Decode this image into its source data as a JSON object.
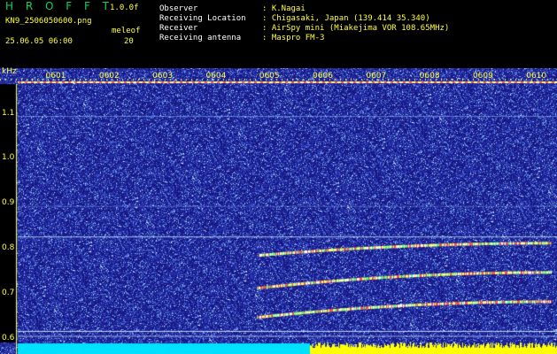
{
  "header": {
    "app_name": "H R O F F T",
    "version": "1.0.0f",
    "filename": "KN9_2506050600.png",
    "datetime": "25.06.05 06:00",
    "shower_code": "meleof",
    "shower_value": "20",
    "fields": [
      {
        "label": "Observer",
        "value": ": K.Nagai"
      },
      {
        "label": "Receiving Location",
        "value": ": Chigasaki, Japan (139.414 35.340)"
      },
      {
        "label": "Receiver",
        "value": ": AirSpy mini (Miakejima VOR 108.65MHz)"
      },
      {
        "label": "Receiving antenna",
        "value": ": Maspro FM-3"
      }
    ]
  },
  "chart_data": {
    "type": "heatmap",
    "ylabel": "kHz",
    "ylim": [
      0.57,
      1.19
    ],
    "x_ticks": [
      "0601",
      "0602",
      "0603",
      "0604",
      "0605",
      "0606",
      "0607",
      "0608",
      "0609",
      "0610"
    ],
    "y_ticks": [
      {
        "label": "1.1",
        "value": 1.1
      },
      {
        "label": "1.0",
        "value": 1.0
      },
      {
        "label": "0.9",
        "value": 0.9
      },
      {
        "label": "0.8",
        "value": 0.8
      },
      {
        "label": "0.7",
        "value": 0.7
      },
      {
        "label": "0.6",
        "value": 0.6
      }
    ],
    "colors": {
      "background": "#1a1a8c",
      "marker": "#ffff40",
      "cyan": "#00e0ff",
      "yellow": "#ffff00"
    }
  }
}
